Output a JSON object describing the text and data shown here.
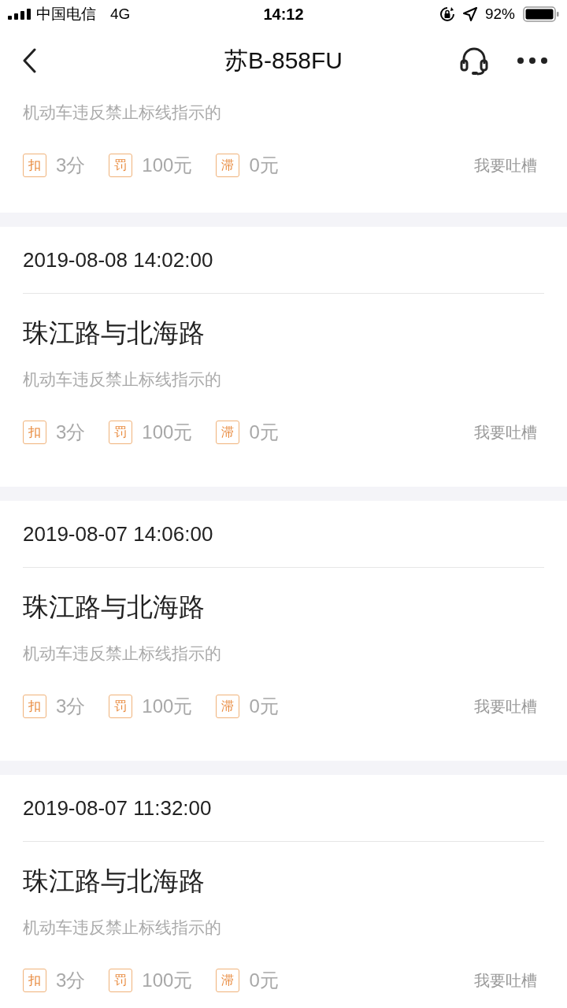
{
  "status_bar": {
    "carrier": "中国电信",
    "network": "4G",
    "time": "14:12",
    "battery": "92%"
  },
  "nav": {
    "title": "苏B-858FU"
  },
  "records": [
    {
      "description": "机动车违反禁止标线指示的",
      "chips": [
        {
          "badge": "扣",
          "value": "3分"
        },
        {
          "badge": "罚",
          "value": "100元"
        },
        {
          "badge": "滞",
          "value": "0元"
        }
      ],
      "action": "我要吐槽"
    },
    {
      "time": "2019-08-08 14:02:00",
      "location": "珠江路与北海路",
      "description": "机动车违反禁止标线指示的",
      "chips": [
        {
          "badge": "扣",
          "value": "3分"
        },
        {
          "badge": "罚",
          "value": "100元"
        },
        {
          "badge": "滞",
          "value": "0元"
        }
      ],
      "action": "我要吐槽"
    },
    {
      "time": "2019-08-07 14:06:00",
      "location": "珠江路与北海路",
      "description": "机动车违反禁止标线指示的",
      "chips": [
        {
          "badge": "扣",
          "value": "3分"
        },
        {
          "badge": "罚",
          "value": "100元"
        },
        {
          "badge": "滞",
          "value": "0元"
        }
      ],
      "action": "我要吐槽"
    },
    {
      "time": "2019-08-07 11:32:00",
      "location": "珠江路与北海路",
      "description": "机动车违反禁止标线指示的",
      "chips": [
        {
          "badge": "扣",
          "value": "3分"
        },
        {
          "badge": "罚",
          "value": "100元"
        },
        {
          "badge": "滞",
          "value": "0元"
        }
      ],
      "action": "我要吐槽"
    }
  ]
}
